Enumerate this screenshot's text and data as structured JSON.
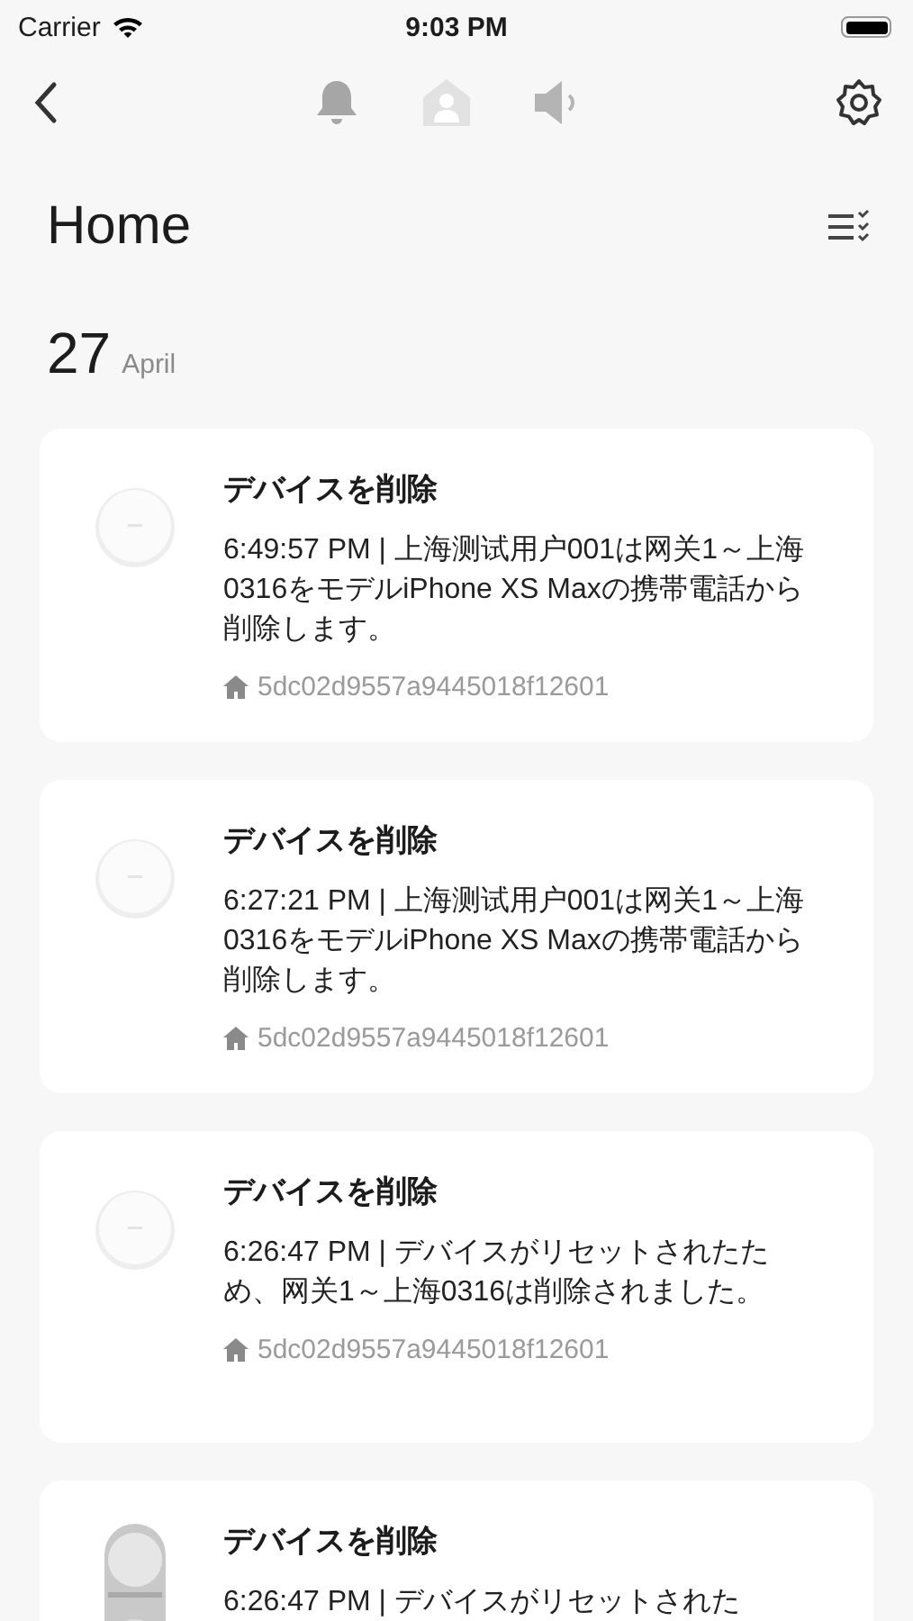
{
  "status_bar": {
    "carrier": "Carrier",
    "time": "9:03 PM"
  },
  "nav": {
    "icons": [
      {
        "kind": "bell",
        "selected": true
      },
      {
        "kind": "home",
        "selected": false
      },
      {
        "kind": "speaker",
        "selected": false
      }
    ]
  },
  "title": "Home",
  "date": {
    "day": "27",
    "month": "April"
  },
  "events": [
    {
      "kind": "hub",
      "title": "デバイスを削除",
      "message": "6:49:57 PM | 上海测试用户001は网关1～上海0316をモデルiPhone XS Maxの携帯電話から削除します。",
      "home_id": "5dc02d9557a9445018f12601"
    },
    {
      "kind": "hub",
      "title": "デバイスを削除",
      "message": "6:27:21 PM | 上海测试用户001は网关1～上海0316をモデルiPhone XS Maxの携帯電話から削除します。",
      "home_id": "5dc02d9557a9445018f12601"
    },
    {
      "kind": "hub",
      "title": "デバイスを削除",
      "message": "6:26:47 PM | デバイスがリセットされたため、网关1～上海0316は削除されました。",
      "home_id": "5dc02d9557a9445018f12601"
    },
    {
      "kind": "lock",
      "title": "デバイスを削除",
      "message": "6:26:47 PM | デバイスがリセットされた"
    }
  ]
}
